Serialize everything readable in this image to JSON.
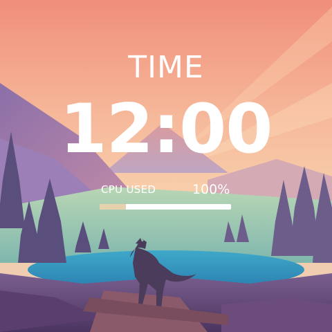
{
  "widget": {
    "title": "TIME",
    "clock": "12:00",
    "cpu_label": "CPU USED",
    "cpu_value": "100%",
    "bar_fill_fraction": 0.2,
    "bar_fill_color": "#e6d1ad",
    "bar_track_color": "#ffffff"
  },
  "wallpaper": {
    "subject": "wolf-by-mountain-lake-at-sunset"
  }
}
